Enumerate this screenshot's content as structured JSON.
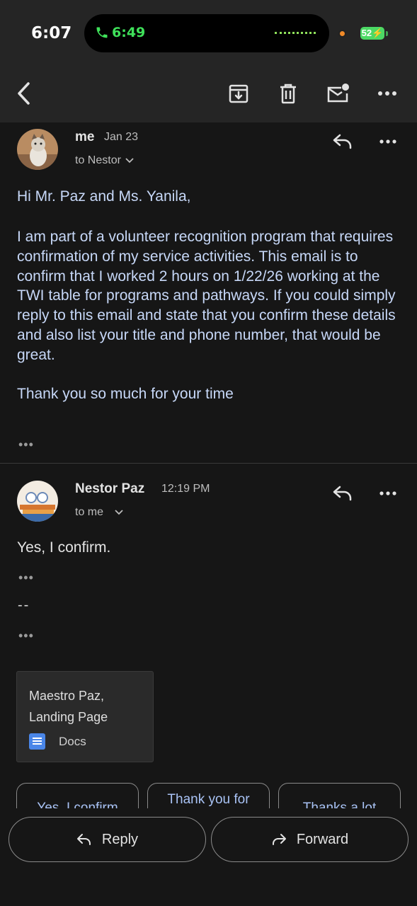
{
  "status_bar": {
    "time": "6:07",
    "call_timer": "6:49",
    "battery": "52"
  },
  "toolbar": {
    "back_icon": "back-arrow-icon",
    "archive_icon": "archive-icon",
    "delete_icon": "trash-icon",
    "mark_unread_icon": "mark-unread-icon",
    "more_icon": "more-horizontal-icon"
  },
  "messages": [
    {
      "sender": "me",
      "date": "Jan 23",
      "to": "to Nestor",
      "greeting": "Hi Mr. Paz and Ms. Yanila,",
      "paragraph": "I am part of a volunteer recognition program that requires confirmation of my service activities. This email is to confirm that I worked 2 hours on 1/22/26 working at the TWI table for programs and pathways. If you could simply reply to this email and state that you confirm these details and also list your title and phone number, that would be great.",
      "closing": "Thank you so much for your time",
      "trimmed": "•••"
    },
    {
      "sender": "Nestor Paz",
      "date": "12:19 PM",
      "to": "to me",
      "body": "Yes, I confirm.",
      "trimmed_1": "•••",
      "signature_sep": "--",
      "trimmed_2": "•••",
      "attachment": {
        "title": "Maestro Paz, Landing Page",
        "type": "Docs"
      }
    }
  ],
  "smart_replies": [
    "Yes, I confirm",
    "Thank you for",
    "Thanks a lot"
  ],
  "actions": {
    "reply": "Reply",
    "forward": "Forward"
  },
  "colors": {
    "background": "#161616",
    "bars": "#252525",
    "quoted_text": "#c7d8f8",
    "call_green": "#3fe15a",
    "chip_text": "#a9c3f5"
  }
}
